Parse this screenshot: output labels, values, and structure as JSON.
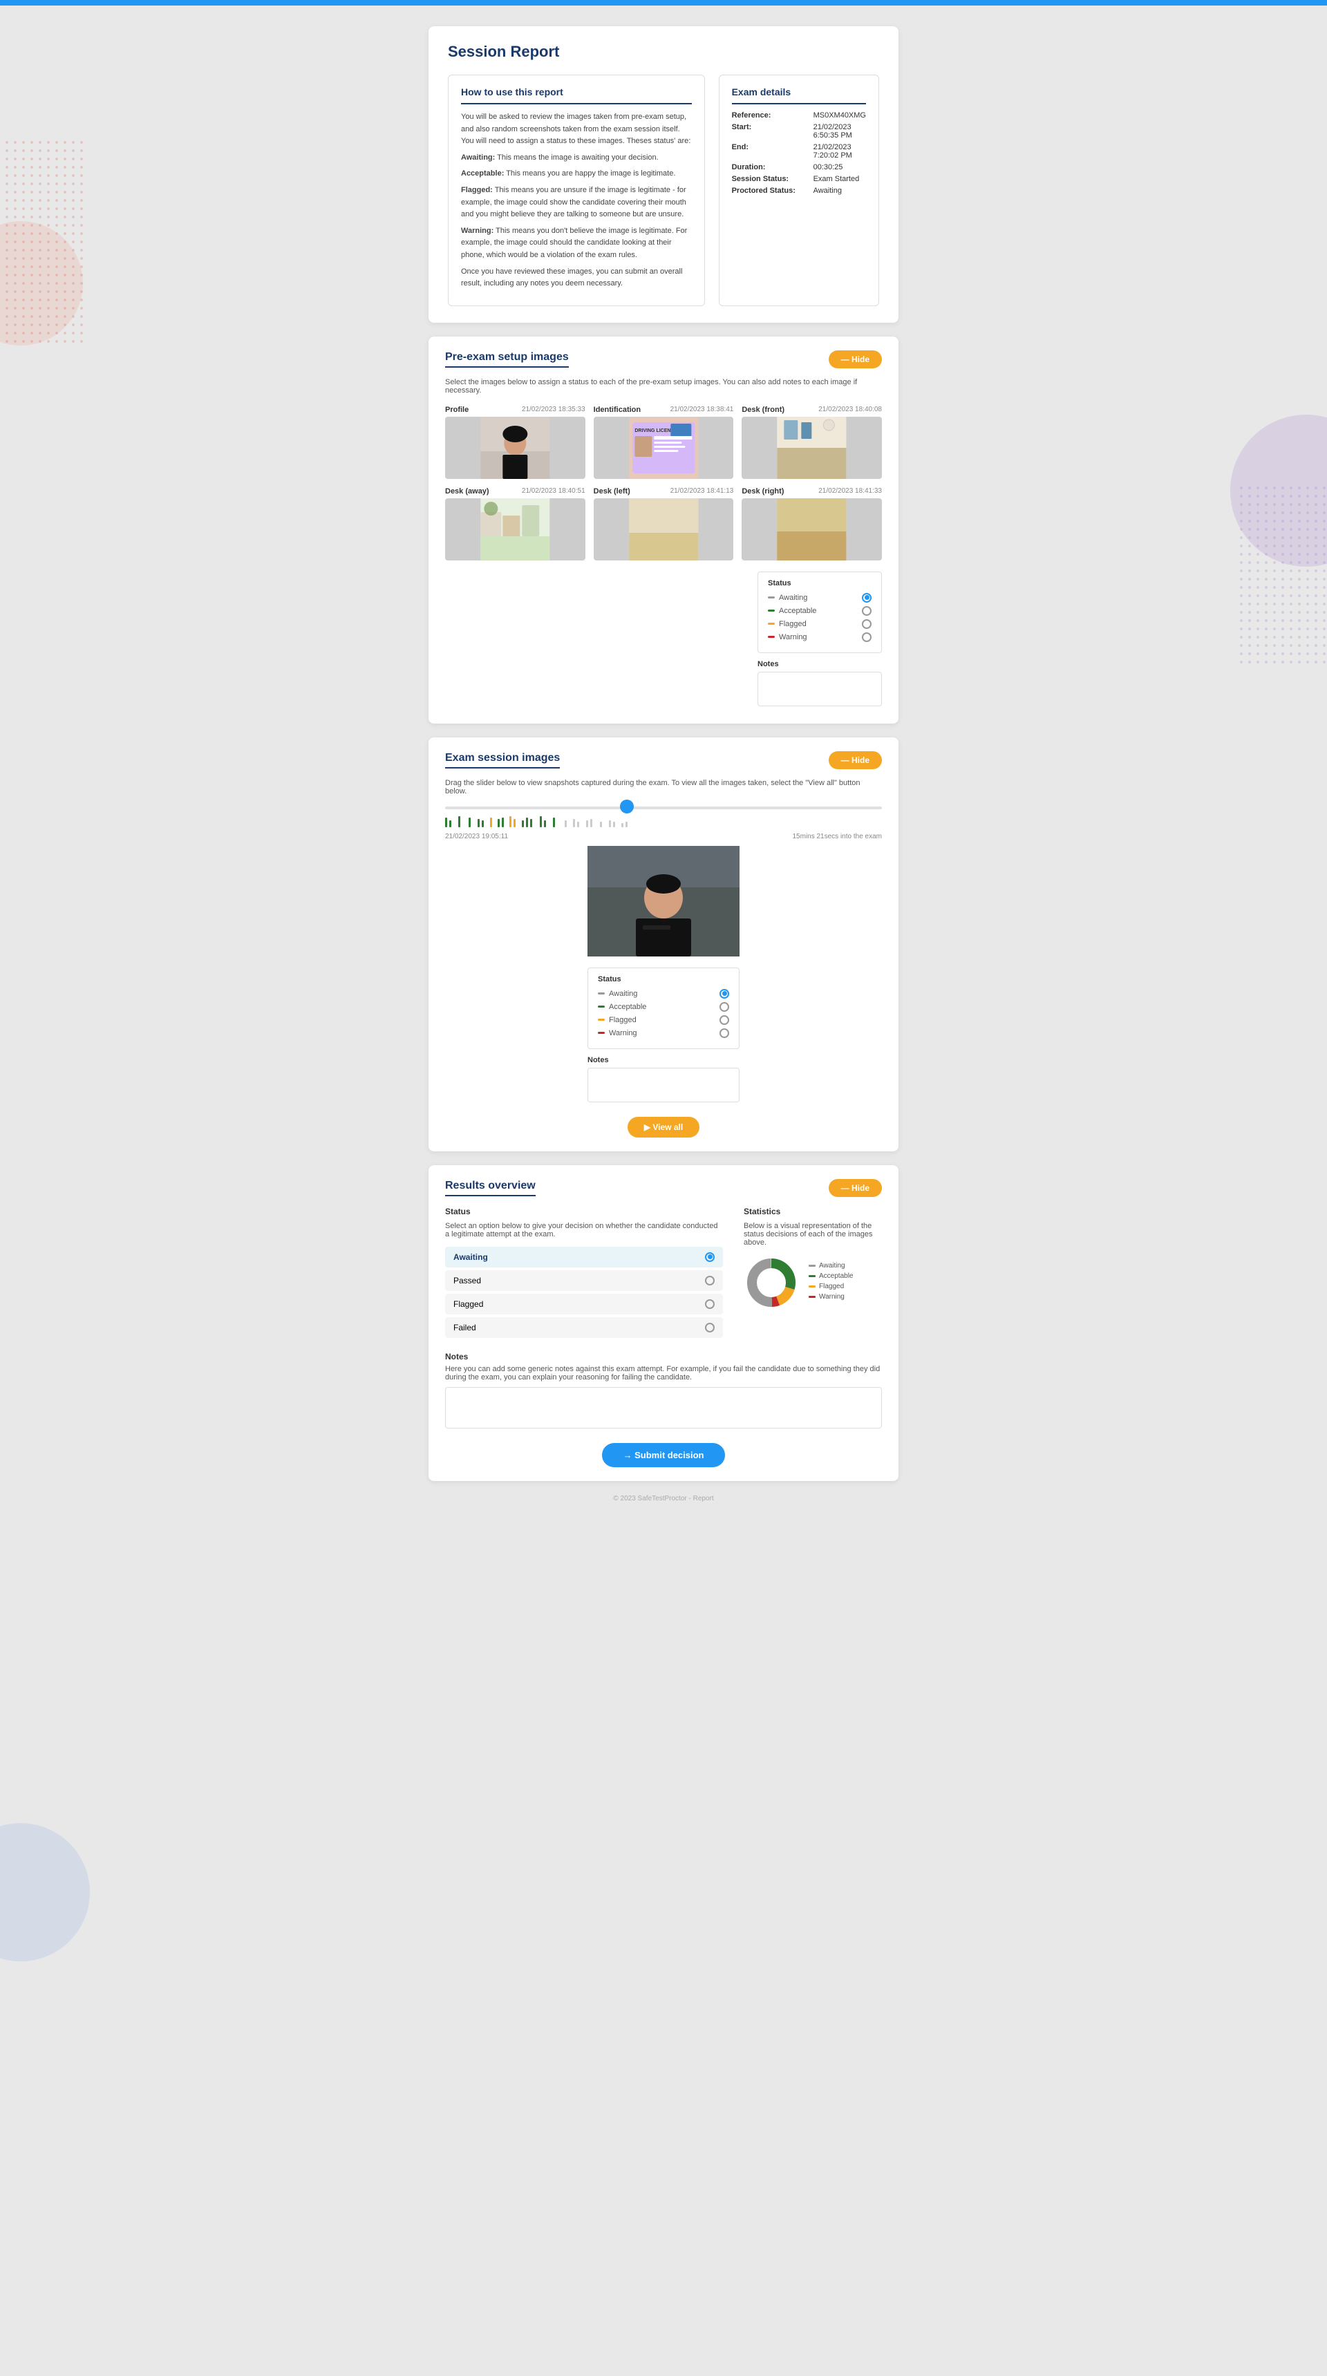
{
  "topBar": {
    "color": "#2196F3"
  },
  "page": {
    "title": "Session Report"
  },
  "howToUse": {
    "title": "How to use this report",
    "intro": "You will be asked to review the images taken from pre-exam setup, and also random screenshots taken from the exam session itself. You will need to assign a status to these images. Theses status' are:",
    "statuses": [
      {
        "label": "Awaiting:",
        "desc": "This means the image is awaiting your decision."
      },
      {
        "label": "Acceptable:",
        "desc": "This means you are happy the image is legitimate."
      },
      {
        "label": "Flagged:",
        "desc": "This means you are unsure if the image is legitimate - for example, the image could show the candidate covering their mouth and you might believe they are talking to someone but are unsure."
      },
      {
        "label": "Warning:",
        "desc": "This means you don't believe the image is legitimate. For example, the image could should the candidate looking at their phone, which would be a violation of the exam rules."
      }
    ],
    "outro": "Once you have reviewed these images, you can submit an overall result, including any notes you deem necessary."
  },
  "examDetails": {
    "title": "Exam details",
    "fields": [
      {
        "label": "Reference:",
        "value": "MS0XM40XMG"
      },
      {
        "label": "Start:",
        "value": "21/02/2023 6:50:35 PM"
      },
      {
        "label": "End:",
        "value": "21/02/2023 7:20:02 PM"
      },
      {
        "label": "Duration:",
        "value": "00:30:25"
      },
      {
        "label": "Session Status:",
        "value": "Exam Started"
      },
      {
        "label": "Proctored Status:",
        "value": "Awaiting"
      }
    ]
  },
  "preExamSection": {
    "title": "Pre-exam setup images",
    "hideLabel": "— Hide",
    "description": "Select the images below to assign a status to each of the pre-exam setup images. You can also add notes to each image if necessary.",
    "images": [
      {
        "label": "Profile",
        "date": "21/02/2023 18:35:33",
        "type": "profile"
      },
      {
        "label": "Identification",
        "date": "21/02/2023 18:38:41",
        "type": "license"
      },
      {
        "label": "Desk (front)",
        "date": "21/02/2023 18:40:08",
        "type": "room"
      },
      {
        "label": "Desk (away)",
        "date": "21/02/2023 18:40:51",
        "type": "room2"
      },
      {
        "label": "Desk (left)",
        "date": "21/02/2023 18:41:13",
        "type": "desk"
      },
      {
        "label": "Desk (right)",
        "date": "21/02/2023 18:41:33",
        "type": "desk2"
      }
    ],
    "status": {
      "title": "Status",
      "options": [
        {
          "label": "Awaiting",
          "selected": true,
          "color": "awaiting"
        },
        {
          "label": "Acceptable",
          "selected": false,
          "color": "acceptable"
        },
        {
          "label": "Flagged",
          "selected": false,
          "color": "flagged"
        },
        {
          "label": "Warning",
          "selected": false,
          "color": "warning"
        }
      ]
    },
    "notesLabel": "Notes",
    "notesPlaceholder": ""
  },
  "examSessionSection": {
    "title": "Exam session images",
    "hideLabel": "— Hide",
    "sliderDesc": "Drag the slider below to view snapshots captured during the exam. To view all the images taken, select the \"View all\" button below.",
    "snapshotDate": "21/02/2023 19:05:11",
    "snapshotOffset": "15mins 21secs into the exam",
    "status": {
      "title": "Status",
      "options": [
        {
          "label": "Awaiting",
          "selected": true,
          "color": "awaiting"
        },
        {
          "label": "Acceptable",
          "selected": false,
          "color": "acceptable"
        },
        {
          "label": "Flagged",
          "selected": false,
          "color": "flagged"
        },
        {
          "label": "Warning",
          "selected": false,
          "color": "warning"
        }
      ]
    },
    "notesLabel": "Notes",
    "notesPlaceholder": "",
    "viewAllLabel": "▶ View all"
  },
  "resultsSection": {
    "title": "Results overview",
    "hideLabel": "— Hide",
    "status": {
      "subtitle": "Status",
      "description": "Select an option below to give your decision on whether the candidate conducted a legitimate attempt at the exam.",
      "options": [
        {
          "label": "Awaiting",
          "selected": true
        },
        {
          "label": "Passed",
          "selected": false
        },
        {
          "label": "Flagged",
          "selected": false
        },
        {
          "label": "Failed",
          "selected": false
        }
      ]
    },
    "statistics": {
      "subtitle": "Statistics",
      "description": "Below is a visual representation of the status decisions of each of the images above.",
      "legend": [
        {
          "label": "Awaiting",
          "color": "#999999"
        },
        {
          "label": "Acceptable",
          "color": "#2e7d32"
        },
        {
          "label": "Flagged",
          "color": "#F5A623"
        },
        {
          "label": "Warning",
          "color": "#c62828"
        }
      ],
      "donut": {
        "awaiting": 50,
        "acceptable": 30,
        "flagged": 15,
        "warning": 5
      }
    },
    "notes": {
      "label": "Notes",
      "description": "Here you can add some generic notes against this exam attempt. For example, if you fail the candidate due to something they did during the exam, you can explain your reasoning for failing the candidate.",
      "placeholder": ""
    },
    "submitLabel": "→ Submit decision"
  },
  "footer": {
    "text": "© 2023 SafeTestProctor - Report"
  }
}
